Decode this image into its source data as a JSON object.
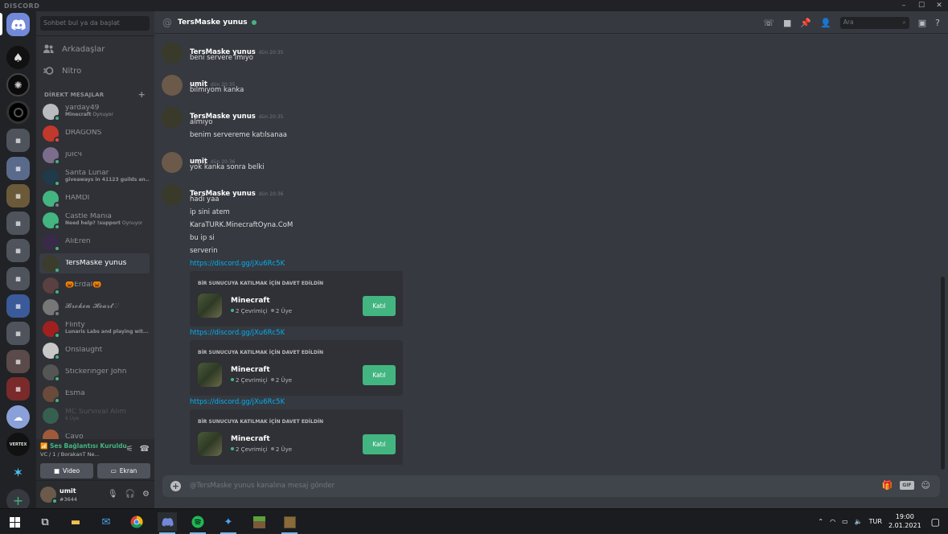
{
  "app": {
    "title": "DISCORD"
  },
  "window_controls": {
    "minimize": "–",
    "maximize": "☐",
    "close": "✕"
  },
  "sidebar": {
    "search_placeholder": "Sohbet bul ya da başlat",
    "friends_label": "Arkadaşlar",
    "nitro_label": "Nitro",
    "section_title": "DİREKT MESAJLAR",
    "add_symbol": "+",
    "dms": [
      {
        "name": "yarday49",
        "status_bold": "Minecraft",
        "status_rest": " Oynuyor",
        "presence": "on",
        "color": "#b9bbbe"
      },
      {
        "name": "DRAGONS",
        "status_bold": "",
        "status_rest": "",
        "presence": "dnd",
        "color": "#c0392b"
      },
      {
        "name": "juicч",
        "status_bold": "",
        "status_rest": "",
        "presence": "on",
        "color": "#7c6d8c"
      },
      {
        "name": "Santa Lunar",
        "status_bold": "giveaways in 41123 guilds an...",
        "status_rest": "",
        "presence": "on",
        "color": "#1f3a4a"
      },
      {
        "name": "HAMDİ",
        "status_bold": "",
        "status_rest": "",
        "presence": "off",
        "color": "#43b581"
      },
      {
        "name": "Castle Mania",
        "status_bold": "Need help? !support",
        "status_rest": " Oynuyor",
        "presence": "on",
        "color": "#43b581"
      },
      {
        "name": "AliEren",
        "status_bold": "",
        "status_rest": "",
        "presence": "on",
        "color": "#3a2a4a"
      },
      {
        "name": "TersMaske yunus",
        "status_bold": "",
        "status_rest": "",
        "presence": "on",
        "color": "#3b3d2a"
      },
      {
        "name": "🎃Erdal🎃",
        "status_bold": "",
        "status_rest": "",
        "presence": "on",
        "color": "#5a4040"
      },
      {
        "name": "𝓑𝓻𝓸𝓴𝓮𝓷 𝓗𝓮𝓪𝓻𝓽♡",
        "status_bold": "",
        "status_rest": "",
        "presence": "off",
        "color": "#777"
      },
      {
        "name": "Flinty",
        "status_bold": "Lunaris Labs and playing wit...",
        "status_rest": "",
        "presence": "on",
        "color": "#a02020"
      },
      {
        "name": "Onslaught",
        "status_bold": "",
        "status_rest": "",
        "presence": "on",
        "color": "#c8c8c8"
      },
      {
        "name": "Stickeringer John",
        "status_bold": "",
        "status_rest": "",
        "presence": "on",
        "color": "#555"
      },
      {
        "name": "Esma",
        "status_bold": "",
        "status_rest": "",
        "presence": "on",
        "color": "#6a4a3a"
      },
      {
        "name": "MC Survival Alım",
        "status_bold": "",
        "status_rest": "6 Üye",
        "presence": "none",
        "color": "#43b581"
      },
      {
        "name": "Cavo",
        "status_bold": "",
        "status_rest": "",
        "presence": "on",
        "color": "#a05a3a"
      }
    ],
    "voice": {
      "title": "Ses Bağlantısı Kuruldu",
      "subtitle": "VC / 1 / BorakanT Ne...",
      "video_label": "Video",
      "screen_label": "Ekran"
    },
    "user": {
      "name": "umit",
      "tag": "#3644"
    }
  },
  "channel": {
    "title": "TersMaske yunus",
    "search_placeholder": "Ara"
  },
  "messages": [
    {
      "author": "TersMaske yunus",
      "time": "dün 20:35",
      "lines": [
        "beni servere lmıyo"
      ]
    },
    {
      "author": "umit",
      "time": "dün 20:35",
      "lines": [
        "bilmiyom kanka"
      ]
    },
    {
      "author": "TersMaske yunus",
      "time": "dün 20:35",
      "lines": [
        "almıyo",
        "benim servereme katılsanaa"
      ]
    },
    {
      "author": "umit",
      "time": "dün 20:36",
      "lines": [
        "yok kanka sonra belki"
      ]
    },
    {
      "author": "TersMaske yunus",
      "time": "dün 20:36",
      "lines": [
        "hadi yaa",
        "ip sini atem",
        "KaraTURK.MinecraftOyna.CoM",
        "bu ip si",
        "serverin"
      ]
    }
  ],
  "invites": [
    {
      "link": "https://discord.gg/jXu6Rc5K",
      "header": "BİR SUNUCUYA KATILMAK İÇİN DAVET EDİLDİN",
      "server": "Minecraft",
      "online": "2 Çevrimiçi",
      "members": "2 Üye",
      "button": "Katıl"
    },
    {
      "link": "https://discord.gg/jXu6Rc5K",
      "header": "BİR SUNUCUYA KATILMAK İÇİN DAVET EDİLDİN",
      "server": "Minecraft",
      "online": "2 Çevrimiçi",
      "members": "2 Üye",
      "button": "Katıl"
    },
    {
      "link": "https://discord.gg/jXu6Rc5K",
      "header": "BİR SUNUCUYA KATILMAK İÇİN DAVET EDİLDİN",
      "server": "Minecraft",
      "online": "2 Çevrimiçi",
      "members": "2 Üye",
      "button": "Katıl"
    }
  ],
  "composer": {
    "placeholder": "@TersMaske yunus kanalına mesaj gönder",
    "gif_label": "GIF"
  },
  "taskbar": {
    "lang": "TUR",
    "time": "19:00",
    "date": "2.01.2021"
  },
  "colors": {
    "accent": "#7289da",
    "online": "#43b581",
    "link": "#00b0f4"
  }
}
